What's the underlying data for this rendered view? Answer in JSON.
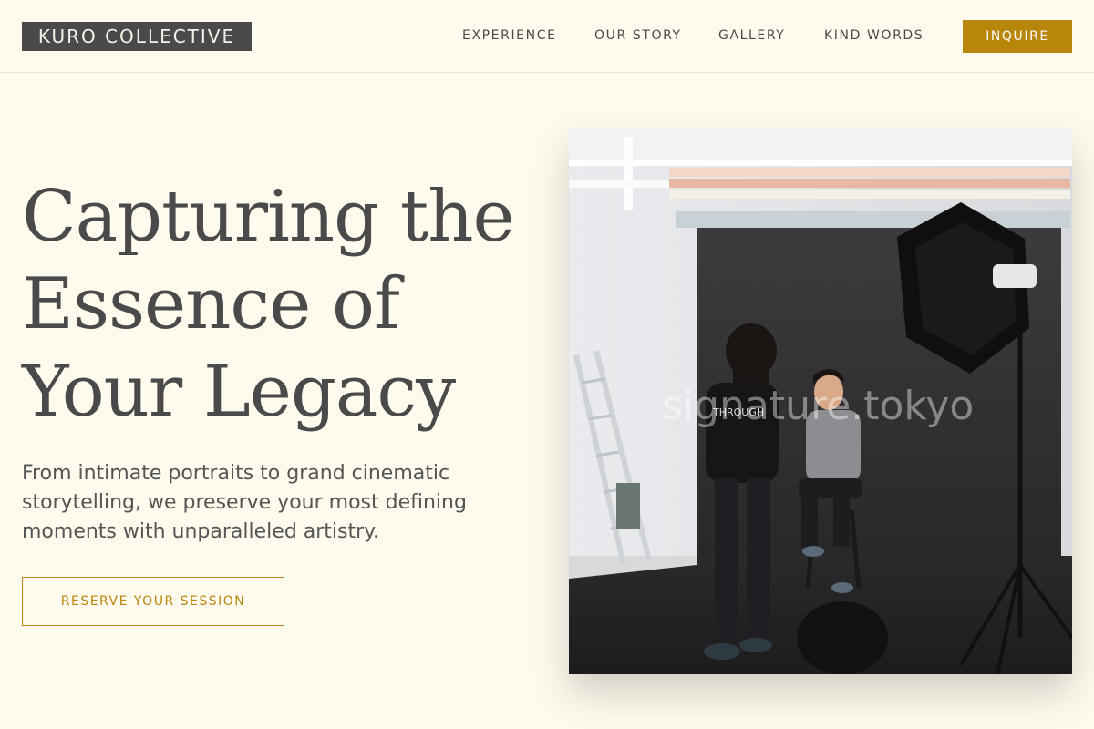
{
  "header": {
    "logo": "KURO COLLECTIVE",
    "nav": [
      {
        "label": "EXPERIENCE"
      },
      {
        "label": "OUR STORY"
      },
      {
        "label": "GALLERY"
      },
      {
        "label": "KIND WORDS"
      }
    ],
    "inquire_label": "INQUIRE"
  },
  "hero": {
    "headline": [
      "Capturing the",
      "Essence of",
      "Your Legacy"
    ],
    "subtext": "From intimate portraits to grand cinematic storytelling, we preserve your most defining moments with unparalleled artistry.",
    "cta_label": "RESERVE YOUR SESSION"
  },
  "photo": {
    "watermark": "signature.tokyo",
    "shirt_text": "THROUGH"
  },
  "colors": {
    "background": "#fefaee",
    "accent": "#b8860b",
    "text": "#4a4a4a"
  }
}
